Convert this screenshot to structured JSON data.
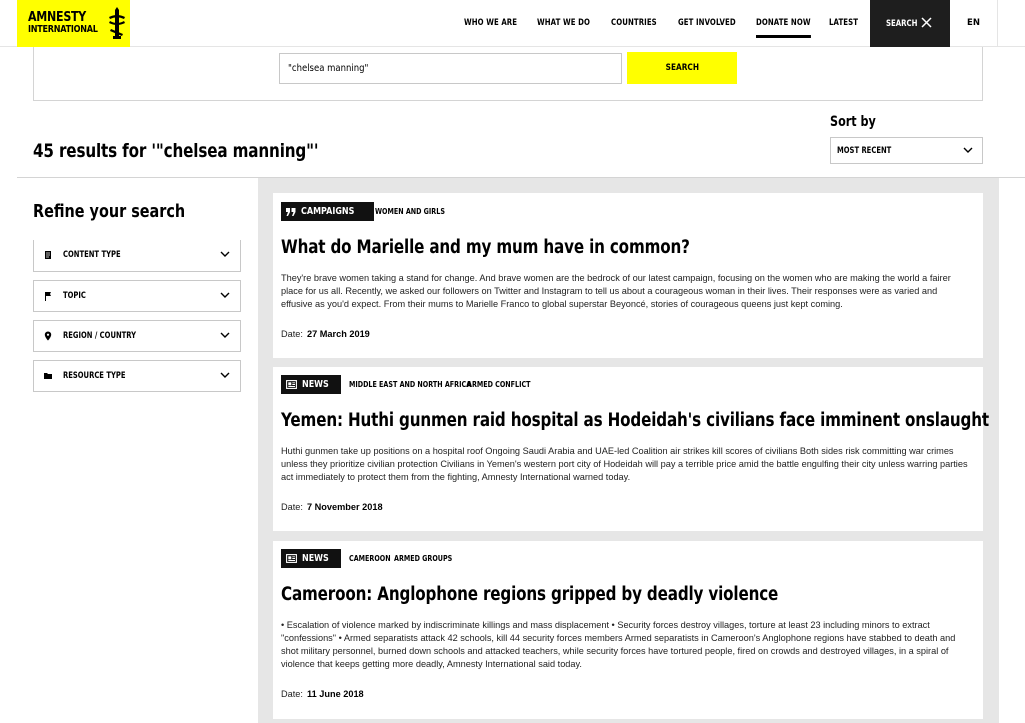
{
  "header": {
    "logo_line1": "AMNESTY",
    "logo_line2": "INTERNATIONAL",
    "nav": [
      "WHO WE ARE",
      "WHAT WE DO",
      "COUNTRIES",
      "GET INVOLVED",
      "DONATE NOW",
      "LATEST"
    ],
    "search_label": "SEARCH",
    "lang": "EN"
  },
  "search": {
    "query": "\"chelsea manning\"",
    "button": "SEARCH"
  },
  "results": {
    "count_text": "45 results for '\"chelsea manning\"'",
    "sort_label": "Sort by",
    "sort_value": "MOST RECENT"
  },
  "sidebar": {
    "title": "Refine your search",
    "filters": [
      {
        "label": "CONTENT TYPE",
        "icon": "document-icon"
      },
      {
        "label": "TOPIC",
        "icon": "flag-icon"
      },
      {
        "label": "REGION / COUNTRY",
        "icon": "location-pin-icon"
      },
      {
        "label": "RESOURCE TYPE",
        "icon": "folder-icon"
      }
    ]
  },
  "cards": [
    {
      "type": "CAMPAIGNS",
      "tags": [
        "WOMEN AND GIRLS"
      ],
      "title": "What do Marielle and my mum have in common?",
      "text": "They're brave women taking a stand for change. And brave women are the bedrock of our latest campaign, focusing on the women who are making the world a fairer place for us all. Recently, we asked our followers on Twitter and Instagram to tell us about a courageous woman in their lives. Their responses were as varied and effusive as you'd expect. From their mums to Marielle Franco to global superstar Beyoncé, stories of courageous queens just kept coming.",
      "date_label": "Date:",
      "date": "27 March 2019"
    },
    {
      "type": "NEWS",
      "tags": [
        "MIDDLE EAST AND NORTH AFRICA",
        "ARMED CONFLICT"
      ],
      "title": "Yemen: Huthi gunmen raid hospital as Hodeidah's civilians face imminent onslaught",
      "text": "Huthi gunmen take up positions on a hospital roof Ongoing Saudi Arabia and UAE-led Coalition air strikes kill scores of civilians Both sides risk committing war crimes unless they prioritize civilian protection   Civilians in Yemen's western port city of Hodeidah will pay a terrible price amid the battle engulfing their city unless warring parties act immediately to protect them from the fighting, Amnesty International warned today.",
      "date_label": "Date:",
      "date": "7 November 2018"
    },
    {
      "type": "NEWS",
      "tags": [
        "CAMEROON",
        "ARMED GROUPS"
      ],
      "title": "Cameroon: Anglophone regions gripped by deadly violence",
      "text": "• Escalation of violence marked by indiscriminate killings and mass displacement • Security forces destroy villages, torture at least 23 including minors to extract \"confessions\" • Armed separatists attack 42 schools, kill 44 security forces members Armed separatists in Cameroon's Anglophone regions have stabbed to death and shot military personnel, burned down schools and attacked teachers, while security forces have tortured people, fired on crowds and destroyed villages, in a spiral of violence that keeps getting more deadly, Amnesty International said today.",
      "date_label": "Date:",
      "date": "11 June 2018"
    }
  ],
  "colors": {
    "brand_yellow": "#ffff00",
    "dark": "#1e1e1e",
    "panel_bg": "#e6e6e6"
  }
}
